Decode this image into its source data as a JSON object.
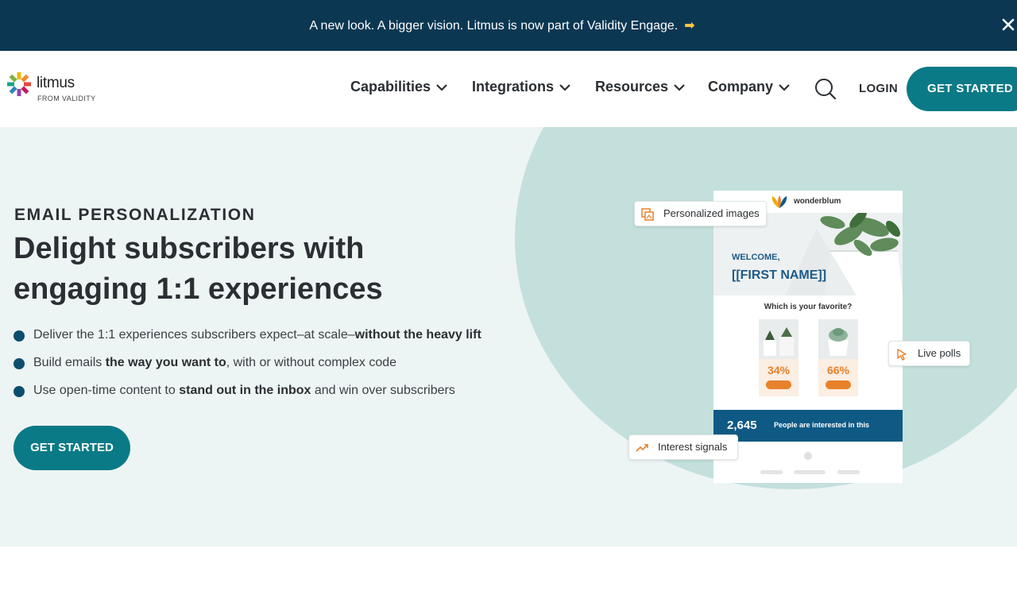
{
  "announcement": {
    "text": "A new look. A bigger vision. Litmus is now part of Validity Engage.",
    "arrow": "➡",
    "close_icon": "close-icon"
  },
  "header": {
    "logo": {
      "name": "litmus",
      "sub": "FROM VALIDITY"
    },
    "nav": [
      {
        "label": "Capabilities"
      },
      {
        "label": "Integrations"
      },
      {
        "label": "Resources"
      },
      {
        "label": "Company"
      }
    ],
    "search_icon": "search-icon",
    "login_label": "LOGIN",
    "cta_label": "GET STARTED"
  },
  "hero": {
    "eyebrow": "EMAIL PERSONALIZATION",
    "headline_line1": "Delight subscribers with",
    "headline_line2": "engaging 1:1 experiences",
    "bullets": [
      {
        "pre": "Deliver the 1:1 experiences subscribers expect–at scale–",
        "bold": "without the heavy lift",
        "post": ""
      },
      {
        "pre": "Build emails ",
        "bold": "the way you want to",
        "post": ", with or without complex code"
      },
      {
        "pre": "Use open-time content to ",
        "bold": "stand out in the inbox",
        "post": " and win over subscribers"
      }
    ],
    "cta_label": "GET STARTED"
  },
  "mockup": {
    "brand": "wonderblum",
    "welcome": "WELCOME,",
    "first_name": "[[FIRST NAME]]",
    "question": "Which is your favorite?",
    "polls": [
      {
        "percent": "34%"
      },
      {
        "percent": "66%"
      }
    ],
    "stat_number": "2,645",
    "stat_text": "People are interested in this",
    "chips": {
      "personalized_images": "Personalized images",
      "live_polls": "Live polls",
      "interest_signals": "Interest signals"
    }
  },
  "colors": {
    "announce_bg": "#0c3752",
    "accent": "#0a7a86",
    "hero_bg": "#edf4f4",
    "circle": "#c3e0dc",
    "orange": "#e8812b",
    "stat_bg": "#0f5a85"
  }
}
